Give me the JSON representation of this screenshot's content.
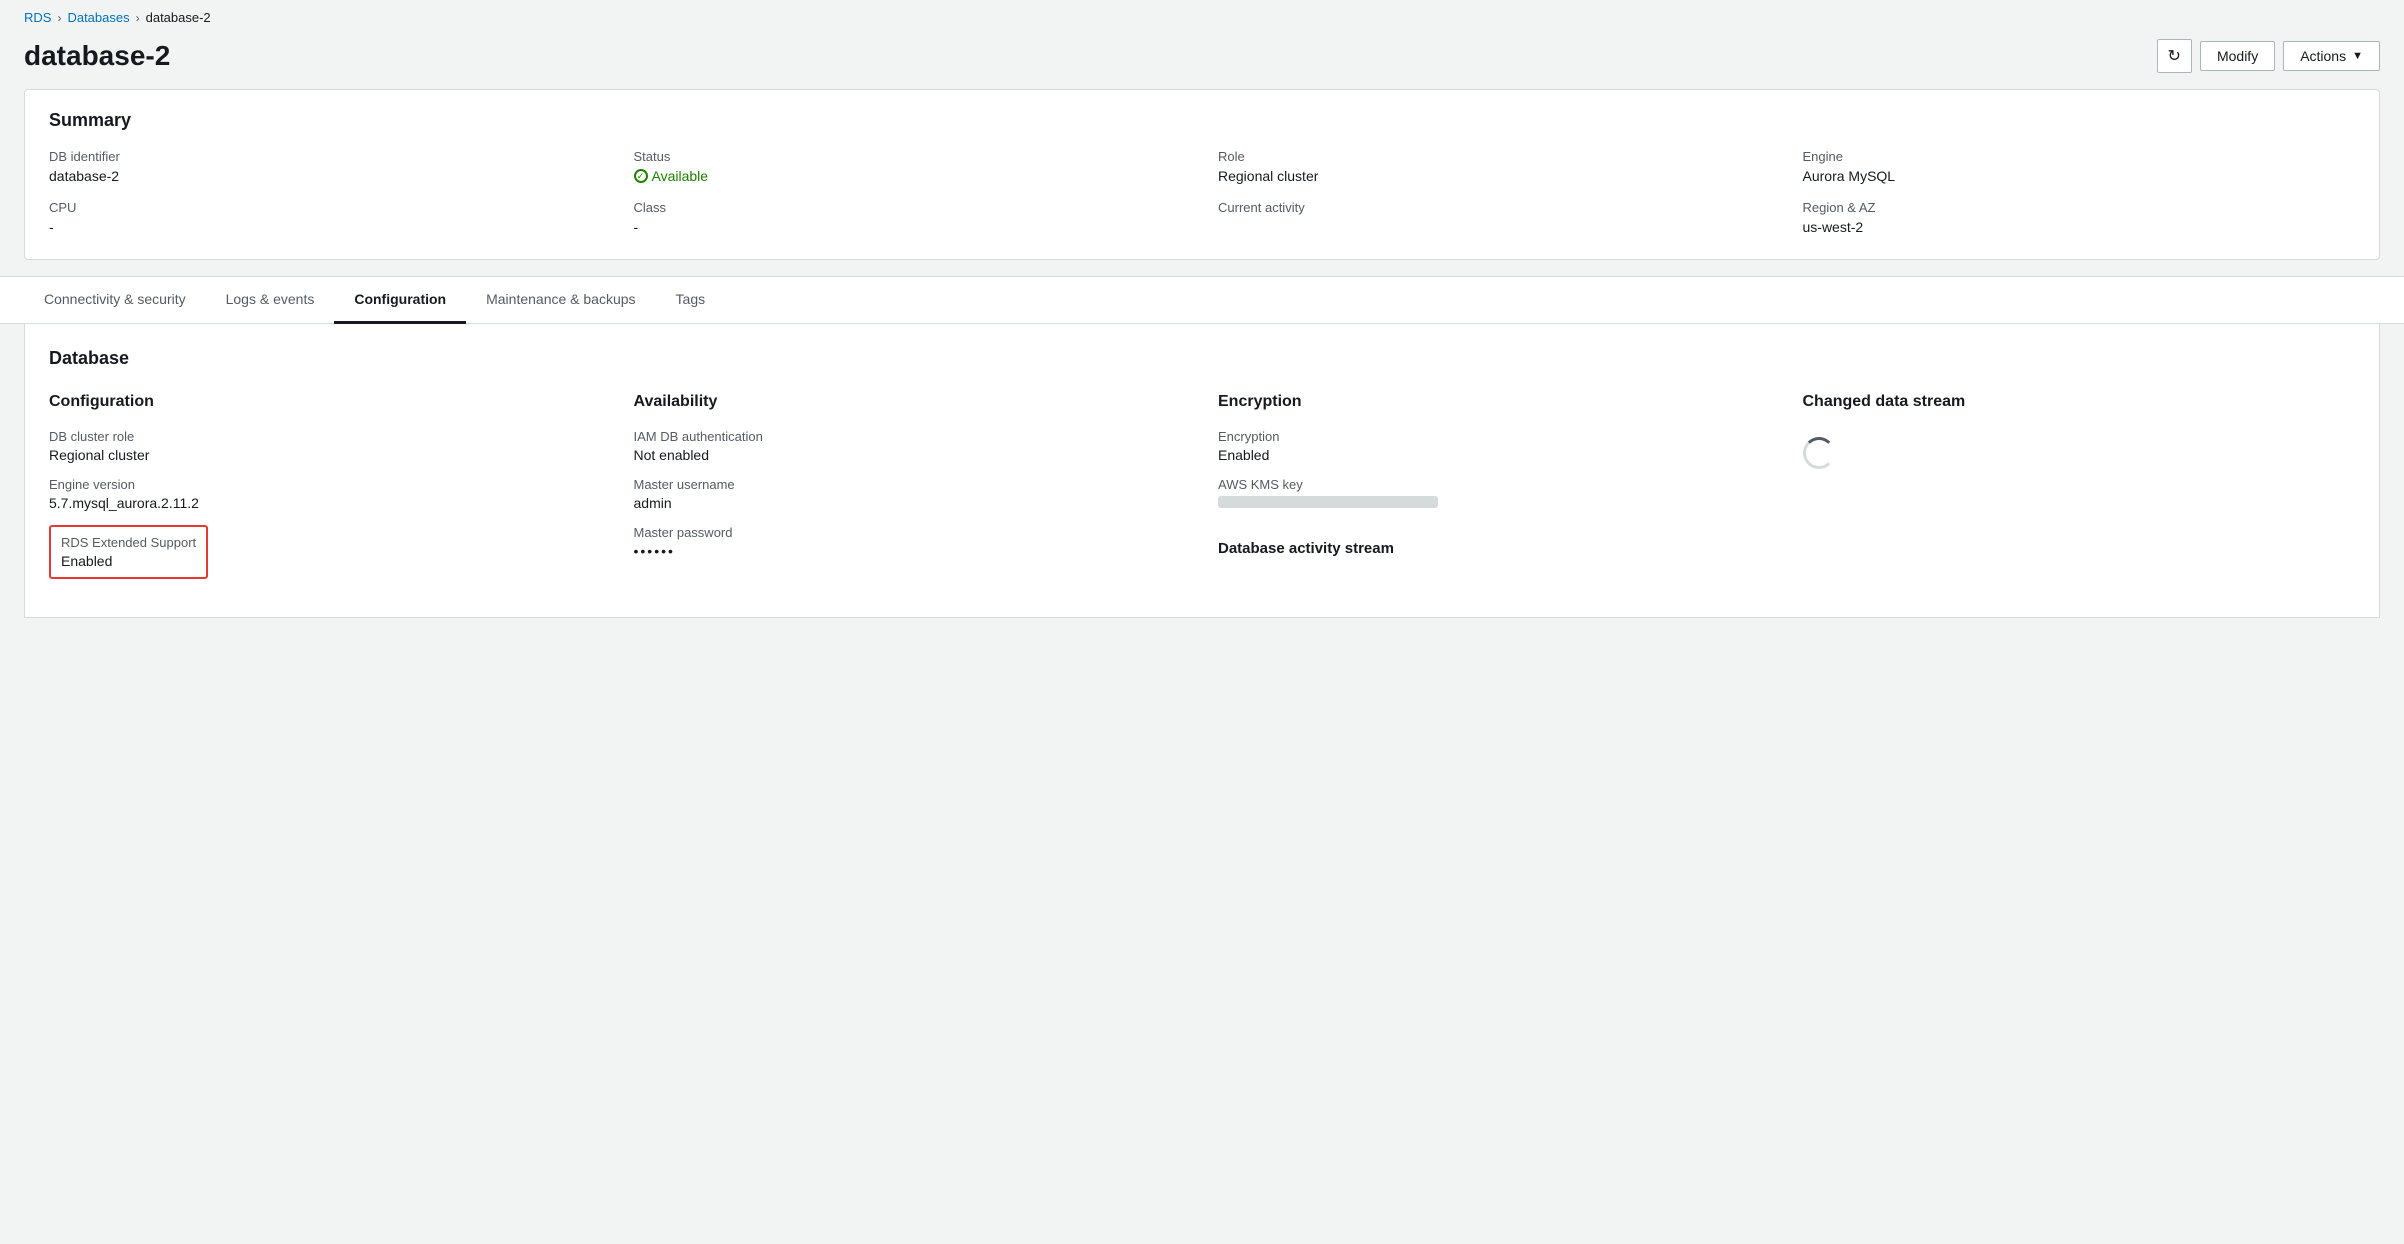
{
  "breadcrumb": {
    "rds": "RDS",
    "databases": "Databases",
    "current": "database-2"
  },
  "page": {
    "title": "database-2"
  },
  "header_buttons": {
    "refresh": "↻",
    "modify": "Modify",
    "actions": "Actions",
    "actions_arrow": "▼"
  },
  "summary": {
    "title": "Summary",
    "db_identifier_label": "DB identifier",
    "db_identifier_value": "database-2",
    "cpu_label": "CPU",
    "cpu_value": "-",
    "status_label": "Status",
    "status_value": "Available",
    "class_label": "Class",
    "class_value": "-",
    "role_label": "Role",
    "role_value": "Regional cluster",
    "current_activity_label": "Current activity",
    "current_activity_value": "",
    "engine_label": "Engine",
    "engine_value": "Aurora MySQL",
    "region_az_label": "Region & AZ",
    "region_az_value": "us-west-2"
  },
  "tabs": [
    {
      "id": "connectivity",
      "label": "Connectivity & security",
      "active": false
    },
    {
      "id": "logs",
      "label": "Logs & events",
      "active": false
    },
    {
      "id": "configuration",
      "label": "Configuration",
      "active": true
    },
    {
      "id": "maintenance",
      "label": "Maintenance & backups",
      "active": false
    },
    {
      "id": "tags",
      "label": "Tags",
      "active": false
    }
  ],
  "database_section": {
    "title": "Database",
    "configuration": {
      "col_title": "Configuration",
      "db_cluster_role_label": "DB cluster role",
      "db_cluster_role_value": "Regional cluster",
      "engine_version_label": "Engine version",
      "engine_version_value": "5.7.mysql_aurora.2.11.2",
      "rds_extended_support_label": "RDS Extended Support",
      "rds_extended_support_value": "Enabled"
    },
    "availability": {
      "col_title": "Availability",
      "iam_db_auth_label": "IAM DB authentication",
      "iam_db_auth_value": "Not enabled",
      "master_username_label": "Master username",
      "master_username_value": "admin",
      "master_password_label": "Master password",
      "master_password_value": "••••••"
    },
    "encryption": {
      "col_title": "Encryption",
      "encryption_label": "Encryption",
      "encryption_value": "Enabled",
      "aws_kms_key_label": "AWS KMS key",
      "database_activity_stream_label": "Database activity stream"
    },
    "changed_data_stream": {
      "col_title": "Changed data stream"
    }
  }
}
